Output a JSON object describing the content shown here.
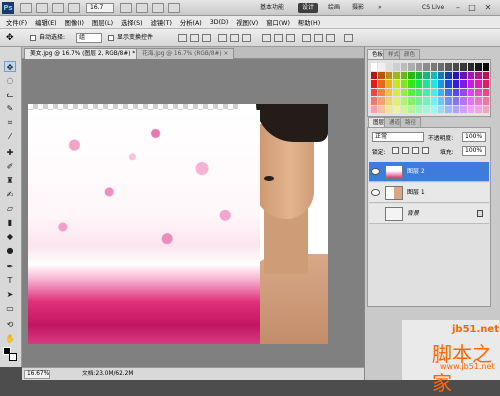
{
  "app": {
    "logo": "Ps",
    "zoom_value": "16.7",
    "workspaces": {
      "basic": "基本功能",
      "design": "设计",
      "paint": "绘画",
      "photo": "摄影",
      "more": "»"
    },
    "cs_live": "CS Live",
    "window_controls": [
      "–",
      "□",
      "✕"
    ]
  },
  "menu": [
    "文件(F)",
    "编辑(E)",
    "图像(I)",
    "图层(L)",
    "选择(S)",
    "滤镜(T)",
    "分析(A)",
    "3D(D)",
    "视图(V)",
    "窗口(W)",
    "帮助(H)"
  ],
  "options": {
    "auto_select_label": "自动选择:",
    "auto_select_value": "组",
    "show_transform_label": "显示变换控件"
  },
  "tabs": [
    {
      "label": "美女.jpg @ 16.7% (图层 2, RGB/8#) *",
      "close": "×"
    },
    {
      "label": "花海.jpg @ 16.7% (RGB/8#)",
      "close": "×"
    }
  ],
  "status": {
    "zoom": "16.67%",
    "doc_size": "文档:23.0M/62.2M"
  },
  "panels": {
    "color_tabs": [
      "色板",
      "样式",
      "颜色"
    ],
    "layer_tabs": [
      "图层",
      "通道",
      "路径"
    ],
    "blend_mode": "正常",
    "opacity_label": "不透明度:",
    "opacity_value": "100%",
    "lock_label": "锁定:",
    "fill_label": "填充:",
    "fill_value": "100%",
    "layers": [
      {
        "name": "图层 2",
        "active": true
      },
      {
        "name": "图层 1",
        "active": false
      },
      {
        "name": "背景",
        "active": false
      }
    ]
  },
  "colors": {
    "active_layer": "#3d7cdb",
    "accent": "#ff6600"
  },
  "watermark": {
    "logo": "jb51.net",
    "text": "脚本之家",
    "url": "www.jb51.net"
  }
}
